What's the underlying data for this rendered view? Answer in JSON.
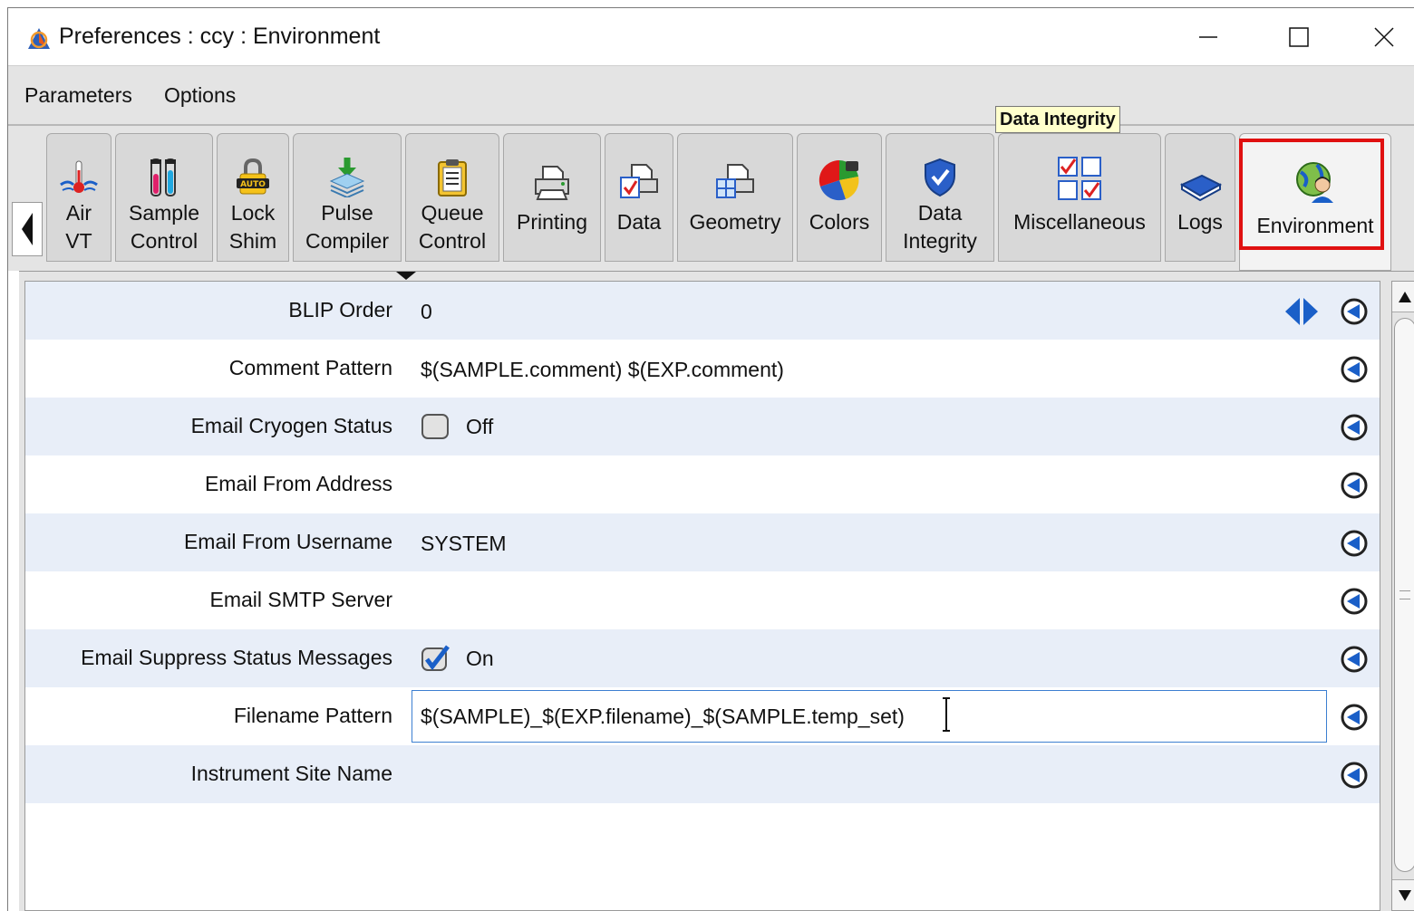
{
  "window": {
    "title": "Preferences : ccy : Environment",
    "icon": "app-logo-icon",
    "buttons": {
      "minimize": "minimize-icon",
      "maximize": "maximize-icon",
      "close": "close-icon"
    }
  },
  "menu": {
    "items": [
      "Parameters",
      "Options"
    ]
  },
  "tooltip": "Data Integrity",
  "tabs": [
    {
      "label": "Air\nVT",
      "icon": "air-vt-icon"
    },
    {
      "label": "Sample\nControl",
      "icon": "test-tubes-icon"
    },
    {
      "label": "Lock\nShim",
      "icon": "auto-lock-icon"
    },
    {
      "label": "Pulse\nCompiler",
      "icon": "stack-download-icon"
    },
    {
      "label": "Queue\nControl",
      "icon": "clipboard-icon"
    },
    {
      "label": "Printing",
      "icon": "printer-icon"
    },
    {
      "label": "Data",
      "icon": "printer-check-icon"
    },
    {
      "label": "Geometry",
      "icon": "printer-grid-icon"
    },
    {
      "label": "Colors",
      "icon": "color-wheel-icon"
    },
    {
      "label": "Data\nIntegrity",
      "icon": "shield-check-icon"
    },
    {
      "label": "Miscellaneous",
      "icon": "checkbox-grid-icon"
    },
    {
      "label": "Logs",
      "icon": "book-icon"
    },
    {
      "label": "Environment",
      "icon": "globe-user-icon",
      "selected": true
    }
  ],
  "settings": [
    {
      "label": "BLIP Order",
      "value": "0",
      "type": "text"
    },
    {
      "label": "Comment Pattern",
      "value": "$(SAMPLE.comment) $(EXP.comment)",
      "type": "text"
    },
    {
      "label": "Email Cryogen Status",
      "value": "Off",
      "type": "checkbox",
      "checked": false
    },
    {
      "label": "Email From Address",
      "value": "",
      "type": "text"
    },
    {
      "label": "Email From Username",
      "value": "SYSTEM",
      "type": "text"
    },
    {
      "label": "Email SMTP Server",
      "value": "",
      "type": "text"
    },
    {
      "label": "Email Suppress Status Messages",
      "value": "On",
      "type": "checkbox",
      "checked": true
    },
    {
      "label": "Filename Pattern",
      "value": "$(SAMPLE)_$(EXP.filename)_$(SAMPLE.temp_set)",
      "type": "input"
    },
    {
      "label": "Instrument Site Name",
      "value": "",
      "type": "text"
    }
  ],
  "colors": {
    "accent": "#2a6fd6",
    "highlight": "#e01010",
    "row_alt": "#e8eef8",
    "tooltip_bg": "#ffffcc"
  }
}
